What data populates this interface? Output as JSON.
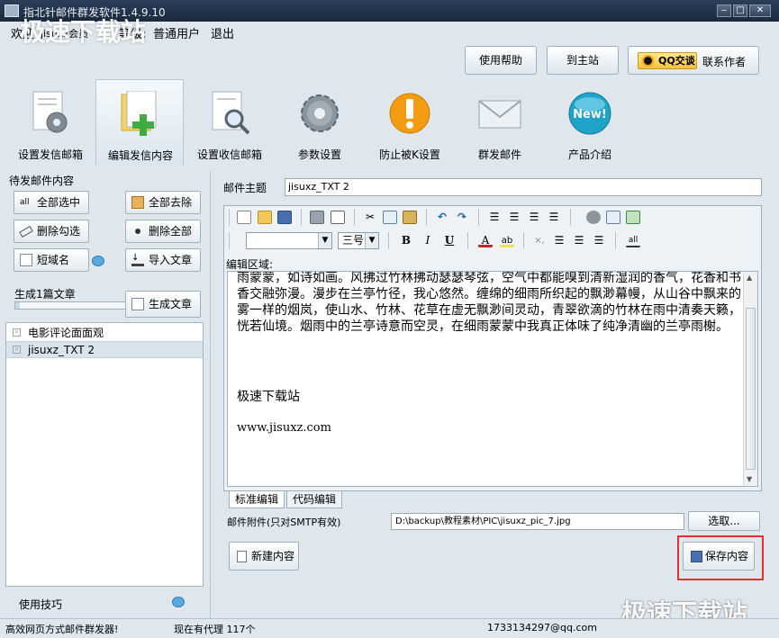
{
  "window": {
    "title": "指北针邮件群发软件1.4.9.10",
    "watermark_top": "极速下载站",
    "watermark_bottom": "极速下载站"
  },
  "menu": {
    "welcome": "欢迎",
    "user": "jisuxz会员",
    "level_label": "等级:",
    "level": "普通用户",
    "logout": "退出"
  },
  "header_buttons": {
    "help": "使用帮助",
    "home": "到主站",
    "qq_badge": "QQ交谈",
    "contact": "联系作者"
  },
  "tabs": [
    {
      "label": "设置发信邮箱",
      "icon": "gear-document-icon"
    },
    {
      "label": "编辑发信内容",
      "icon": "add-document-icon"
    },
    {
      "label": "设置收信邮箱",
      "icon": "search-document-icon"
    },
    {
      "label": "参数设置",
      "icon": "gear-icon"
    },
    {
      "label": "防止被K设置",
      "icon": "warning-icon"
    },
    {
      "label": "群发邮件",
      "icon": "envelope-icon"
    },
    {
      "label": "产品介绍",
      "icon": "new-badge-icon"
    }
  ],
  "left": {
    "title": "待发邮件内容",
    "select_all": "全部选中",
    "remove_all": "全部去除",
    "delete_checked": "删除勾选",
    "delete_all": "删除全部",
    "short_domain": "短域名",
    "import_article": "导入文章",
    "generated": "生成1篇文章",
    "generate": "生成文章",
    "generate_progress": 0.03,
    "items": [
      "电影评论面面观",
      "jisuxz_TXT 2"
    ],
    "tips": "使用技巧"
  },
  "editor": {
    "subject_label": "邮件主题",
    "subject_value": "jisuxz_TXT 2",
    "font_name": "",
    "font_size": "三号",
    "area_label": "编辑区域:",
    "paragraph": "雨蒙蒙，如诗如画。风拂过竹林拂动瑟瑟琴弦，空气中都能嗅到清新湿润的香气，花香和书香交融弥漫。漫步在兰亭竹径，我心悠然。缠绵的细雨所织起的飘渺幕幔，从山谷中飘来的雾一样的烟岚，使山水、竹林、花草在虚无飘渺间灵动，青翠欲滴的竹林在雨中清奏天籁，恍若仙境。烟雨中的兰亭诗意而空灵，在细雨蒙蒙中我真正体味了纯净清幽的兰亭雨榭。",
    "line2": "极速下载站",
    "line3": "www.jisuxz.com",
    "mode_standard": "标准编辑",
    "mode_code": "代码编辑",
    "attachment_label": "邮件附件(只对SMTP有效)",
    "attachment_value": "D:\\backup\\教程素材\\PIC\\jisuxz_pic_7.jpg",
    "browse": "选取...",
    "new_content": "新建内容",
    "save_content": "保存内容"
  },
  "status": {
    "slogan": "高效网页方式邮件群发器!",
    "proxy": "现在有代理 117个",
    "email": "1733134297@qq.com"
  },
  "colors": {
    "title_bar": "#1b2a3e",
    "highlight_border": "#e03030",
    "accent_orange": "#f39c12"
  }
}
